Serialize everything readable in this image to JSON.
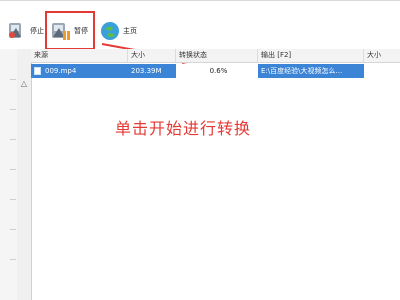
{
  "toolbar": {
    "stop_label": "停止",
    "pause_label": "暂停",
    "home_label": "主页"
  },
  "table": {
    "columns": [
      "来源",
      "大小",
      "转换状态",
      "输出 [F2]",
      "大小"
    ],
    "rows": [
      {
        "source": "009.mp4",
        "size": "203.39M",
        "status": "0.6%",
        "output": "E:\\百度经验\\大视频怎么...",
        "out_size": ""
      }
    ]
  },
  "annotation": {
    "text": "单击开始进行转换",
    "color": "#e53935"
  },
  "colors": {
    "highlight": "#e53935",
    "selection": "#3b84d6"
  }
}
